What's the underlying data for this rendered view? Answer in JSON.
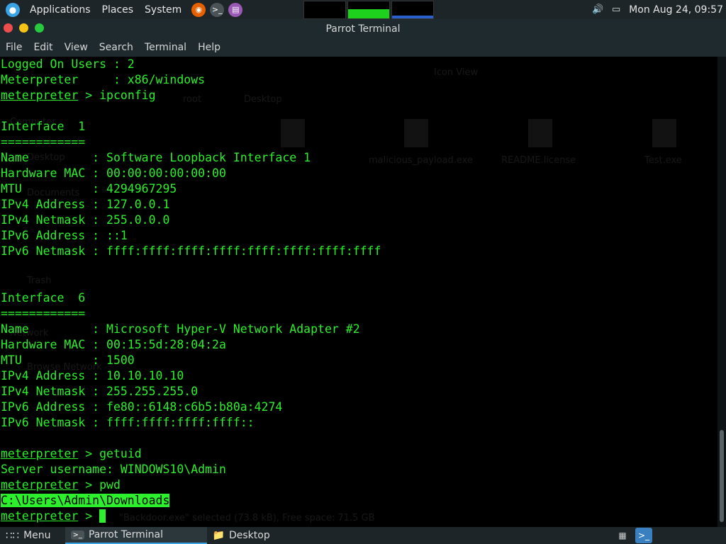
{
  "topbar": {
    "menus": [
      "Applications",
      "Places",
      "System"
    ],
    "clock": "Mon Aug 24, 09:57",
    "monitor_levels": [
      0.0,
      0.55,
      0.15
    ]
  },
  "window": {
    "title": "Parrot Terminal",
    "menu": [
      "File",
      "Edit",
      "View",
      "Search",
      "Terminal",
      "Help"
    ]
  },
  "terminal": {
    "lines": [
      {
        "text": "Logged On Users : 2"
      },
      {
        "text": "Meterpreter     : x86/windows"
      },
      {
        "prompt": "meterpreter",
        "cmd": " > ipconfig"
      },
      {
        "text": ""
      },
      {
        "text": "Interface  1"
      },
      {
        "text": "============"
      },
      {
        "text": "Name         : Software Loopback Interface 1"
      },
      {
        "text": "Hardware MAC : 00:00:00:00:00:00"
      },
      {
        "text": "MTU          : 4294967295"
      },
      {
        "text": "IPv4 Address : 127.0.0.1"
      },
      {
        "text": "IPv4 Netmask : 255.0.0.0"
      },
      {
        "text": "IPv6 Address : ::1"
      },
      {
        "text": "IPv6 Netmask : ffff:ffff:ffff:ffff:ffff:ffff:ffff:ffff"
      },
      {
        "text": ""
      },
      {
        "text": ""
      },
      {
        "text": "Interface  6"
      },
      {
        "text": "============"
      },
      {
        "text": "Name         : Microsoft Hyper-V Network Adapter #2"
      },
      {
        "text": "Hardware MAC : 00:15:5d:28:04:2a"
      },
      {
        "text": "MTU          : 1500"
      },
      {
        "text": "IPv4 Address : 10.10.10.10"
      },
      {
        "text": "IPv4 Netmask : 255.255.255.0"
      },
      {
        "text": "IPv6 Address : fe80::6148:c6b5:b80a:4274"
      },
      {
        "text": "IPv6 Netmask : ffff:ffff:ffff:ffff::"
      },
      {
        "text": ""
      },
      {
        "prompt": "meterpreter",
        "cmd": " > getuid"
      },
      {
        "text": "Server username: WINDOWS10\\Admin"
      },
      {
        "prompt": "meterpreter",
        "cmd": " > pwd"
      },
      {
        "highlight": "C:\\Users\\Admin\\Downloads"
      },
      {
        "prompt": "meterpreter",
        "cmd": " > ",
        "cursor": true
      }
    ]
  },
  "background_ghost": {
    "path": [
      "/",
      "root",
      "Desktop"
    ],
    "view_label": "Icon View",
    "files": [
      "malicious_payload.exe",
      "README.license",
      "Test.exe"
    ],
    "places": [
      "Computer",
      "Desktop",
      "Documents",
      "Trash",
      "Network",
      "Browse Network"
    ],
    "status": "\"Backdoor.exe\" selected (73.8 kB), Free space: 71.5 GB"
  },
  "taskbar": {
    "menu_label": "Menu",
    "items": [
      {
        "label": "Parrot Terminal",
        "active": true
      },
      {
        "label": "Desktop",
        "active": false
      }
    ]
  },
  "colors": {
    "terminal_fg": "#2bf02b",
    "terminal_bg": "#000000",
    "panel_bg": "#1d2528",
    "accent": "#3aa3e3"
  }
}
